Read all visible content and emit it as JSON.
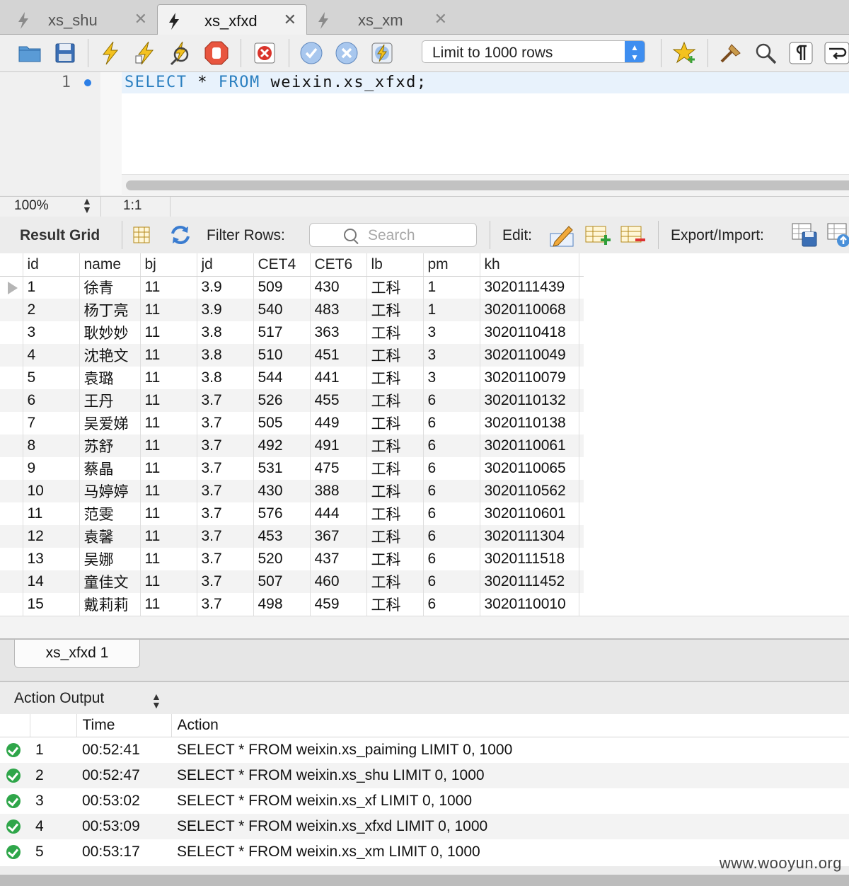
{
  "tabs": [
    {
      "label": "xs_shu",
      "close": "✕",
      "active": false
    },
    {
      "label": "xs_xfxd",
      "close": "✕",
      "active": true
    },
    {
      "label": "xs_xm",
      "close": "✕",
      "active": false
    }
  ],
  "toolbar": {
    "limit_value": "Limit to 1000 rows",
    "icons": [
      "open-folder-icon",
      "save-icon",
      "execute-icon",
      "execute-current-icon",
      "explain-icon",
      "stop-icon",
      "toggle-error-stop-icon",
      "commit-icon",
      "rollback-icon",
      "autocommit-icon",
      "favorite-snippet-icon",
      "beautify-icon",
      "find-icon",
      "invisible-chars-icon",
      "wrap-icon"
    ]
  },
  "editor": {
    "line_number": "1",
    "sql_select": "SELECT",
    "sql_star": " * ",
    "sql_from": "FROM",
    "sql_rest": " weixin.xs_xfxd;"
  },
  "status": {
    "zoom": "100%",
    "cursor": "1:1"
  },
  "result_toolbar": {
    "result_grid_label": "Result Grid",
    "filter_label": "Filter Rows:",
    "search_placeholder": "Search",
    "edit_label": "Edit:",
    "export_label": "Export/Import:"
  },
  "grid": {
    "columns": [
      "id",
      "name",
      "bj",
      "jd",
      "CET4",
      "CET6",
      "lb",
      "pm",
      "kh"
    ],
    "rows": [
      [
        "1",
        "徐青",
        "11",
        "3.9",
        "509",
        "430",
        "工科",
        "1",
        "3020111439"
      ],
      [
        "2",
        "杨丁亮",
        "11",
        "3.9",
        "540",
        "483",
        "工科",
        "1",
        "3020110068"
      ],
      [
        "3",
        "耿妙妙",
        "11",
        "3.8",
        "517",
        "363",
        "工科",
        "3",
        "3020110418"
      ],
      [
        "4",
        "沈艳文",
        "11",
        "3.8",
        "510",
        "451",
        "工科",
        "3",
        "3020110049"
      ],
      [
        "5",
        "袁璐",
        "11",
        "3.8",
        "544",
        "441",
        "工科",
        "3",
        "3020110079"
      ],
      [
        "6",
        "王丹",
        "11",
        "3.7",
        "526",
        "455",
        "工科",
        "6",
        "3020110132"
      ],
      [
        "7",
        "吴爱娣",
        "11",
        "3.7",
        "505",
        "449",
        "工科",
        "6",
        "3020110138"
      ],
      [
        "8",
        "苏舒",
        "11",
        "3.7",
        "492",
        "491",
        "工科",
        "6",
        "3020110061"
      ],
      [
        "9",
        "蔡晶",
        "11",
        "3.7",
        "531",
        "475",
        "工科",
        "6",
        "3020110065"
      ],
      [
        "10",
        "马婷婷",
        "11",
        "3.7",
        "430",
        "388",
        "工科",
        "6",
        "3020110562"
      ],
      [
        "11",
        "范雯",
        "11",
        "3.7",
        "576",
        "444",
        "工科",
        "6",
        "3020110601"
      ],
      [
        "12",
        "袁馨",
        "11",
        "3.7",
        "453",
        "367",
        "工科",
        "6",
        "3020111304"
      ],
      [
        "13",
        "吴娜",
        "11",
        "3.7",
        "520",
        "437",
        "工科",
        "6",
        "3020111518"
      ],
      [
        "14",
        "童佳文",
        "11",
        "3.7",
        "507",
        "460",
        "工科",
        "6",
        "3020111452"
      ],
      [
        "15",
        "戴莉莉",
        "11",
        "3.7",
        "498",
        "459",
        "工科",
        "6",
        "3020110010"
      ]
    ]
  },
  "result_tab": {
    "label": "xs_xfxd 1"
  },
  "action_output": {
    "title": "Action Output",
    "columns": [
      "",
      "Time",
      "Action"
    ],
    "rows": [
      {
        "n": "1",
        "time": "00:52:41",
        "action": "SELECT * FROM weixin.xs_paiming LIMIT 0, 1000"
      },
      {
        "n": "2",
        "time": "00:52:47",
        "action": "SELECT * FROM weixin.xs_shu LIMIT 0, 1000"
      },
      {
        "n": "3",
        "time": "00:53:02",
        "action": "SELECT * FROM weixin.xs_xf LIMIT 0, 1000"
      },
      {
        "n": "4",
        "time": "00:53:09",
        "action": "SELECT * FROM weixin.xs_xfxd LIMIT 0, 1000"
      },
      {
        "n": "5",
        "time": "00:53:17",
        "action": "SELECT * FROM weixin.xs_xm LIMIT 0, 1000"
      }
    ]
  },
  "watermark": "www.wooyun.org"
}
